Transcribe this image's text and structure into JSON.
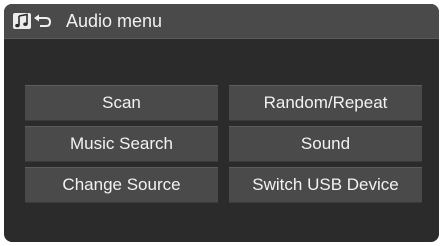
{
  "header": {
    "title": "Audio menu",
    "mode_icon": "music-note-icon",
    "back_icon": "back-arrow-icon"
  },
  "menu": {
    "scan": "Scan",
    "random_repeat": "Random/Repeat",
    "music_search": "Music Search",
    "sound": "Sound",
    "change_source": "Change Source",
    "switch_usb_device": "Switch USB Device"
  },
  "colors": {
    "screen_background": "#2b2b2b",
    "button_background": "#4a4a4a",
    "text": "#f2f2f2"
  }
}
